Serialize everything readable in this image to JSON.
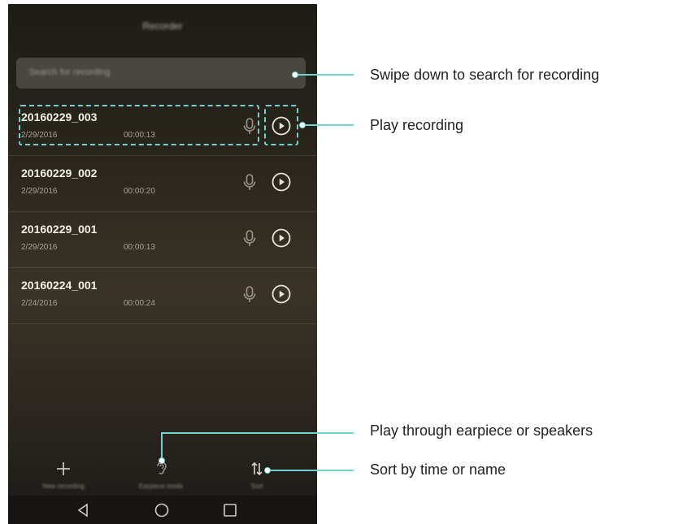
{
  "screen": {
    "title": "Recorder",
    "search_placeholder": "Search for recording"
  },
  "recordings": [
    {
      "name": "20160229_003",
      "date": "2/29/2016",
      "duration": "00:00:13"
    },
    {
      "name": "20160229_002",
      "date": "2/29/2016",
      "duration": "00:00:20"
    },
    {
      "name": "20160229_001",
      "date": "2/29/2016",
      "duration": "00:00:13"
    },
    {
      "name": "20160224_001",
      "date": "2/24/2016",
      "duration": "00:00:24"
    }
  ],
  "bottom_bar": {
    "new_label": "New recording",
    "earpiece_label": "Earpiece mode",
    "sort_label": "Sort"
  },
  "callouts": {
    "search": "Swipe down to search for recording",
    "play": "Play recording",
    "earpiece": "Play through earpiece or speakers",
    "sort": "Sort by time or name"
  },
  "colors": {
    "annotation": "#6fd3cf",
    "phone_bg": "#2a261d",
    "text_primary": "#f3f0e8"
  },
  "icons": {
    "mic": "microphone-icon",
    "play": "play-circle-icon",
    "add": "plus-icon",
    "earpiece": "ear-icon",
    "sort": "sort-arrows-icon",
    "back": "back-triangle-icon",
    "home": "home-circle-icon",
    "recents": "recents-square-icon"
  }
}
